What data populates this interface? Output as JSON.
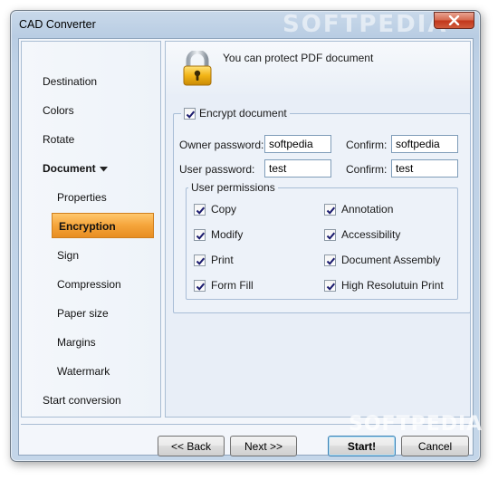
{
  "window": {
    "title": "CAD Converter",
    "watermark": "SOFTPEDIA",
    "watermark_bottom": "SOFTPEDIA"
  },
  "sidebar": {
    "items": [
      {
        "label": "Destination"
      },
      {
        "label": "Colors"
      },
      {
        "label": "Rotate"
      },
      {
        "label": "Document"
      },
      {
        "label": "Properties"
      },
      {
        "label": "Encryption"
      },
      {
        "label": "Sign"
      },
      {
        "label": "Compression"
      },
      {
        "label": "Paper size"
      },
      {
        "label": "Margins"
      },
      {
        "label": "Watermark"
      },
      {
        "label": "Start conversion"
      }
    ],
    "active": "Encryption"
  },
  "main": {
    "header_text": "You can protect PDF document",
    "encrypt_label": "Encrypt document",
    "encrypt_checked": true,
    "owner_password_label": "Owner password:",
    "owner_password_value": "softpedia",
    "owner_confirm_label": "Confirm:",
    "owner_confirm_value": "softpedia",
    "user_password_label": "User password:",
    "user_password_value": "test",
    "user_confirm_label": "Confirm:",
    "user_confirm_value": "test",
    "permissions_label": "User permissions",
    "permissions": [
      {
        "label": "Copy",
        "checked": true
      },
      {
        "label": "Annotation",
        "checked": true
      },
      {
        "label": "Modify",
        "checked": true
      },
      {
        "label": "Accessibility",
        "checked": true
      },
      {
        "label": "Print",
        "checked": true
      },
      {
        "label": "Document Assembly",
        "checked": true
      },
      {
        "label": "Form Fill",
        "checked": true
      },
      {
        "label": "High Resolutuin Print",
        "checked": true
      }
    ]
  },
  "footer": {
    "back_label": "<< Back",
    "next_label": "Next >>",
    "start_label": "Start!",
    "cancel_label": "Cancel"
  },
  "colors": {
    "accent_orange": "#f5a43a",
    "window_blue": "#b9cde3",
    "close_red": "#c2361b"
  },
  "icons": {
    "lock": "lock-icon",
    "close": "close-icon",
    "chevron": "chevron-down-icon",
    "check": "check-icon"
  }
}
